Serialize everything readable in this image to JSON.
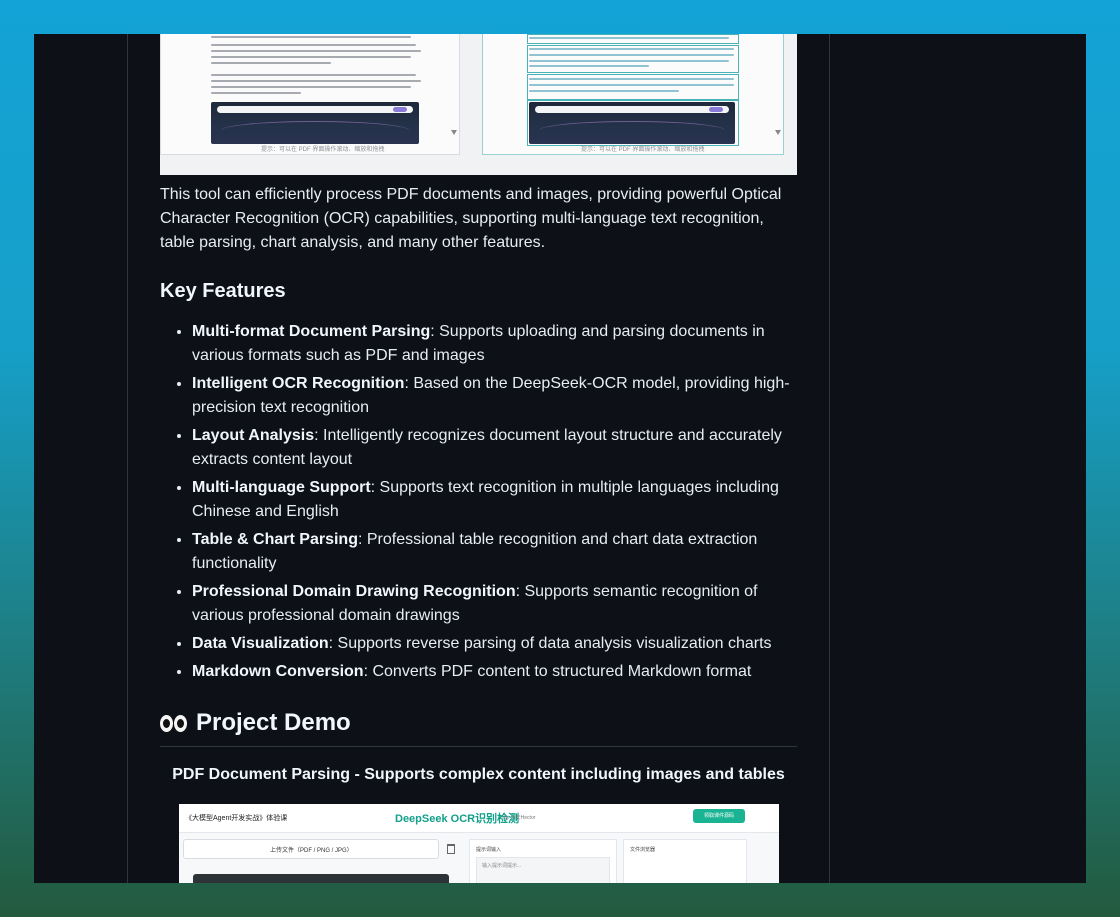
{
  "colors": {
    "background_top": "#14a3d6",
    "background_bottom": "#235a3e",
    "page_bg": "#0d1117",
    "text": "#e6edf3",
    "border": "#30363d",
    "accent_teal": "#1ab394"
  },
  "top_screenshot": {
    "left_tip": "提示：可以在 PDF 界面操作滚动、缩放和拖拽",
    "right_tip": "提示：可以在 PDF 界面操作滚动、缩放和拖拽"
  },
  "intro": "This tool can efficiently process PDF documents and images, providing powerful Optical Character Recognition (OCR) capabilities, supporting multi-language text recognition, table parsing, chart analysis, and many other features.",
  "key_features": {
    "heading": "Key Features",
    "items": [
      {
        "title": "Multi-format Document Parsing",
        "desc": ": Supports uploading and parsing documents in various formats such as PDF and images"
      },
      {
        "title": "Intelligent OCR Recognition",
        "desc": ": Based on the DeepSeek-OCR model, providing high-precision text recognition"
      },
      {
        "title": "Layout Analysis",
        "desc": ": Intelligently recognizes document layout structure and accurately extracts content layout"
      },
      {
        "title": "Multi-language Support",
        "desc": ": Supports text recognition in multiple languages including Chinese and English"
      },
      {
        "title": "Table & Chart Parsing",
        "desc": ": Professional table recognition and chart data extraction functionality"
      },
      {
        "title": "Professional Domain Drawing Recognition",
        "desc": ": Supports semantic recognition of various professional domain drawings"
      },
      {
        "title": "Data Visualization",
        "desc": ": Supports reverse parsing of data analysis visualization charts"
      },
      {
        "title": "Markdown Conversion",
        "desc": ": Converts PDF content to structured Markdown format"
      }
    ]
  },
  "demo": {
    "heading": "Project Demo",
    "caption": "PDF Document Parsing - Supports complex content including images and tables",
    "app": {
      "left_title": "《大模型Agent开发实战》体验课",
      "title": "DeepSeek OCR识别检测",
      "by": "by 九天Hector",
      "header_button": "领取课件源码",
      "upload_label": "上传文件（PDF / PNG / JPG）",
      "mid_label": "提示词输入",
      "mid_placeholder": "输入提示词提示...",
      "right_label": "文件浏览器"
    }
  }
}
